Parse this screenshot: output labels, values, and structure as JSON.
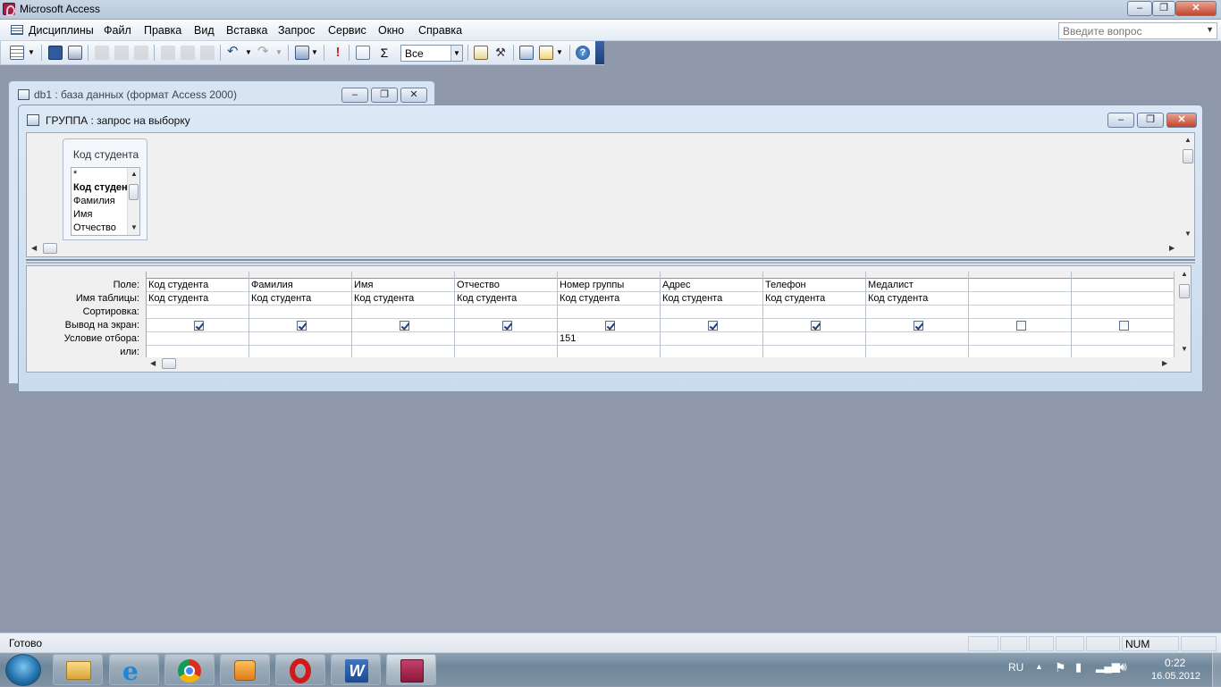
{
  "app": {
    "title": "Microsoft Access"
  },
  "menu": {
    "items": [
      "Дисциплины",
      "Файл",
      "Правка",
      "Вид",
      "Вставка",
      "Запрос",
      "Сервис",
      "Окно",
      "Справка"
    ]
  },
  "ask": {
    "placeholder": "Введите вопрос"
  },
  "toolbar": {
    "top_values": "Все",
    "sigma": "Σ",
    "run": "!"
  },
  "db_window": {
    "title": "db1 : база данных (формат Access 2000)"
  },
  "query_window": {
    "title": "ГРУППА : запрос на выборку"
  },
  "field_list": {
    "table": "Код студента",
    "items": [
      "*",
      "Код студента",
      "Фамилия",
      "Имя",
      "Отчество"
    ]
  },
  "grid": {
    "row_labels": [
      "Поле:",
      "Имя таблицы:",
      "Сортировка:",
      "Вывод на экран:",
      "Условие отбора:",
      "или:"
    ],
    "columns": [
      {
        "field": "Код студента",
        "table": "Код студента",
        "show": true,
        "criteria": ""
      },
      {
        "field": "Фамилия",
        "table": "Код студента",
        "show": true,
        "criteria": ""
      },
      {
        "field": "Имя",
        "table": "Код студента",
        "show": true,
        "criteria": ""
      },
      {
        "field": "Отчество",
        "table": "Код студента",
        "show": true,
        "criteria": ""
      },
      {
        "field": "Номер группы",
        "table": "Код студента",
        "show": true,
        "criteria": "151"
      },
      {
        "field": "Адрес",
        "table": "Код студента",
        "show": true,
        "criteria": ""
      },
      {
        "field": "Телефон",
        "table": "Код студента",
        "show": true,
        "criteria": ""
      },
      {
        "field": "Медалист",
        "table": "Код студента",
        "show": true,
        "criteria": ""
      },
      {
        "field": "",
        "table": "",
        "show": false,
        "criteria": ""
      },
      {
        "field": "",
        "table": "",
        "show": false,
        "criteria": ""
      }
    ]
  },
  "status": {
    "text": "Готово",
    "num": "NUM"
  },
  "tray": {
    "lang": "RU",
    "time": "0:22",
    "date": "16.05.2012"
  }
}
